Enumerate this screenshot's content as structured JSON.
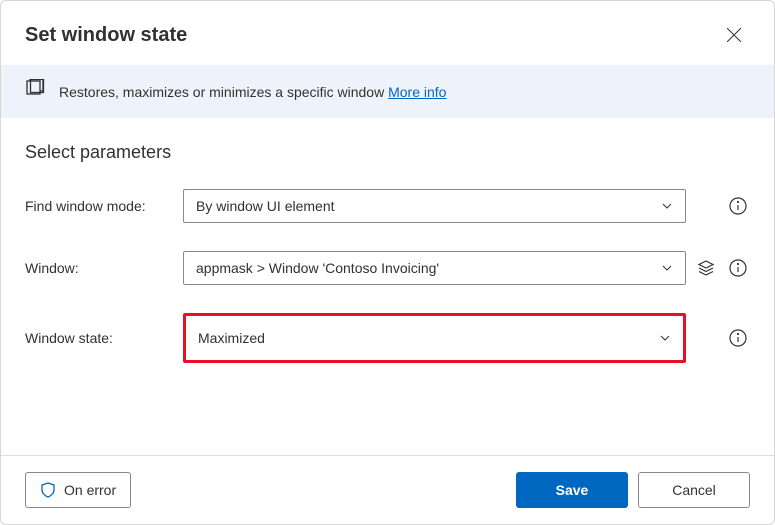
{
  "header": {
    "title": "Set window state"
  },
  "info_bar": {
    "text": "Restores, maximizes or minimizes a specific window ",
    "link": "More info"
  },
  "section_title": "Select parameters",
  "parameters": {
    "find_mode": {
      "label": "Find window mode:",
      "value": "By window UI element"
    },
    "window": {
      "label": "Window:",
      "value": "appmask > Window 'Contoso Invoicing'"
    },
    "window_state": {
      "label": "Window state:",
      "value": "Maximized"
    }
  },
  "footer": {
    "on_error": "On error",
    "save": "Save",
    "cancel": "Cancel"
  }
}
